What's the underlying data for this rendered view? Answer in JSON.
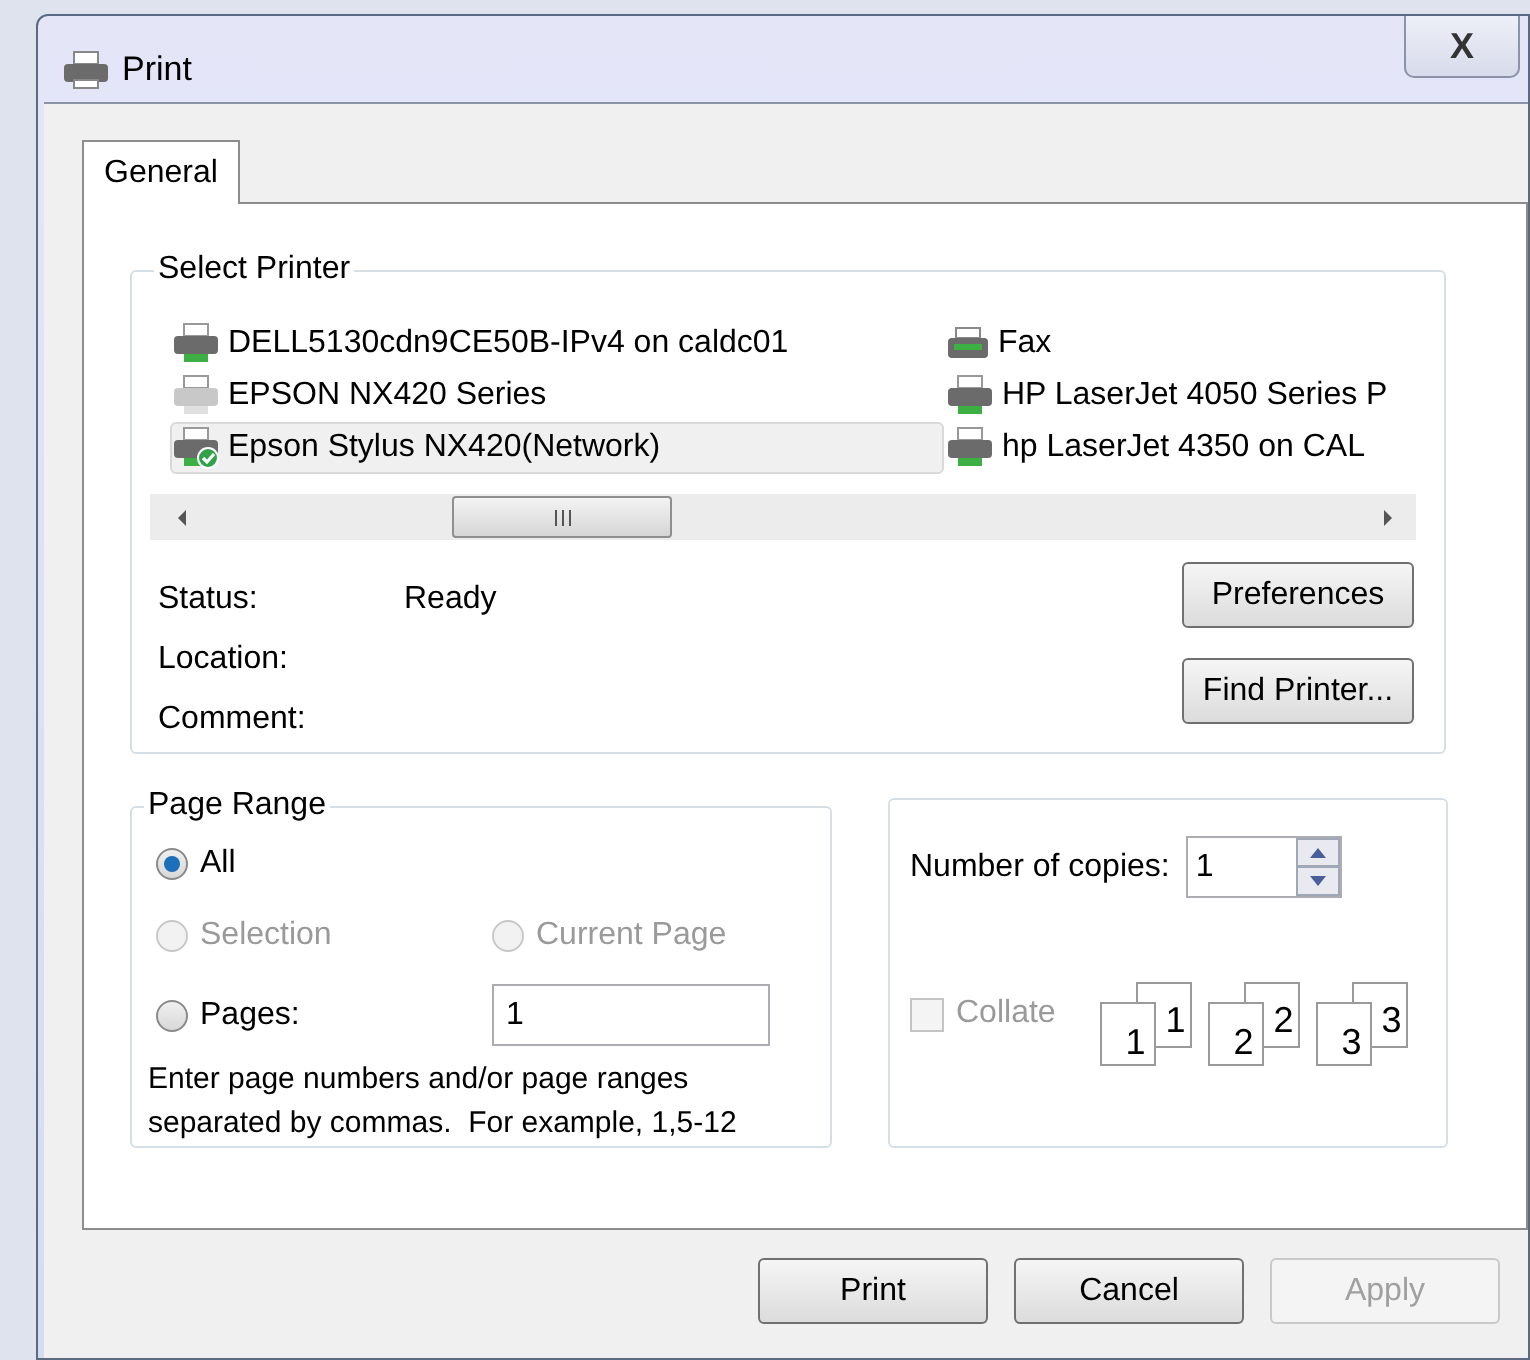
{
  "window": {
    "title": "Print",
    "close": "X"
  },
  "tabs": [
    {
      "label": "General",
      "selected": true
    }
  ],
  "select_printer": {
    "title": "Select Printer",
    "printers": [
      {
        "name": "DELL5130cdn9CE50B-IPv4 on caldc01",
        "kind": "printer",
        "selected": false,
        "default": false,
        "offline": false
      },
      {
        "name": "EPSON NX420 Series",
        "kind": "printer",
        "selected": false,
        "default": false,
        "offline": true
      },
      {
        "name": "Epson Stylus NX420(Network)",
        "kind": "printer",
        "selected": true,
        "default": true,
        "offline": false
      },
      {
        "name": "Fax",
        "kind": "fax",
        "selected": false,
        "default": false,
        "offline": false
      },
      {
        "name": "HP LaserJet 4050 Series P",
        "kind": "printer",
        "selected": false,
        "default": false,
        "offline": false
      },
      {
        "name": "hp LaserJet 4350 on CAL",
        "kind": "printer",
        "selected": false,
        "default": false,
        "offline": false
      }
    ],
    "status_label": "Status:",
    "status": "Ready",
    "location_label": "Location:",
    "comment_label": "Comment:",
    "buttons": [
      "Preferences",
      "Find Printer..."
    ]
  },
  "page_range": {
    "title": "Page Range",
    "options": [
      {
        "label": "All",
        "selected": true,
        "disabled": false
      },
      {
        "label": "Selection",
        "selected": false,
        "disabled": true
      },
      {
        "label": "Current Page",
        "selected": false,
        "disabled": true
      },
      {
        "label": "Pages:",
        "selected": false,
        "disabled": false
      }
    ],
    "pages_value": "1",
    "hint_lines": [
      "Enter page numbers and/or page ranges",
      "separated by commas.  For example, 1,5-12"
    ]
  },
  "copies": {
    "label": "Number of copies:",
    "value": "1",
    "collate": {
      "label": "Collate",
      "checked": false,
      "disabled": true
    },
    "collate_sample": [
      {
        "back": "1",
        "front": "1"
      },
      {
        "back": "2",
        "front": "2"
      },
      {
        "back": "3",
        "front": "3"
      }
    ]
  },
  "buttons": [
    {
      "label": "Print",
      "disabled": false
    },
    {
      "label": "Cancel",
      "disabled": false
    },
    {
      "label": "Apply",
      "disabled": true
    }
  ]
}
